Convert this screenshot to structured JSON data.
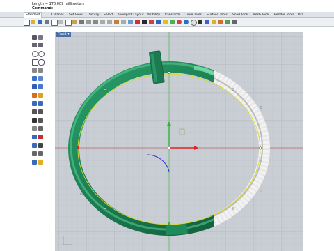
{
  "command_history": {
    "line1": "Length = 170.009 millimeters",
    "prompt": "Command:"
  },
  "tabs": [
    {
      "label": "Standard",
      "active": true
    },
    {
      "label": "CPlanes"
    },
    {
      "label": "Set View"
    },
    {
      "label": "Display"
    },
    {
      "label": "Select"
    },
    {
      "label": "Viewport Layout"
    },
    {
      "label": "Visibility"
    },
    {
      "label": "Transform"
    },
    {
      "label": "Curve Tools"
    },
    {
      "label": "Surface Tools"
    },
    {
      "label": "Solid Tools"
    },
    {
      "label": "Mesh Tools"
    },
    {
      "label": "Render Tools"
    },
    {
      "label": "Dra"
    }
  ],
  "viewport": {
    "title": "Front",
    "dropdown_glyph": "▾"
  },
  "colors": {
    "viewport_bg": "#c9ced4",
    "grid_minor": "#bcc2c9",
    "grid_major": "#aeb5bd",
    "x_axis": "#e02020",
    "y_axis": "#2fb52f",
    "ring_green": "#1f8a5a",
    "ring_white": "#e8e8e8",
    "curve_yellow": "#d8d820",
    "arc_blue": "#2a2ad0"
  }
}
